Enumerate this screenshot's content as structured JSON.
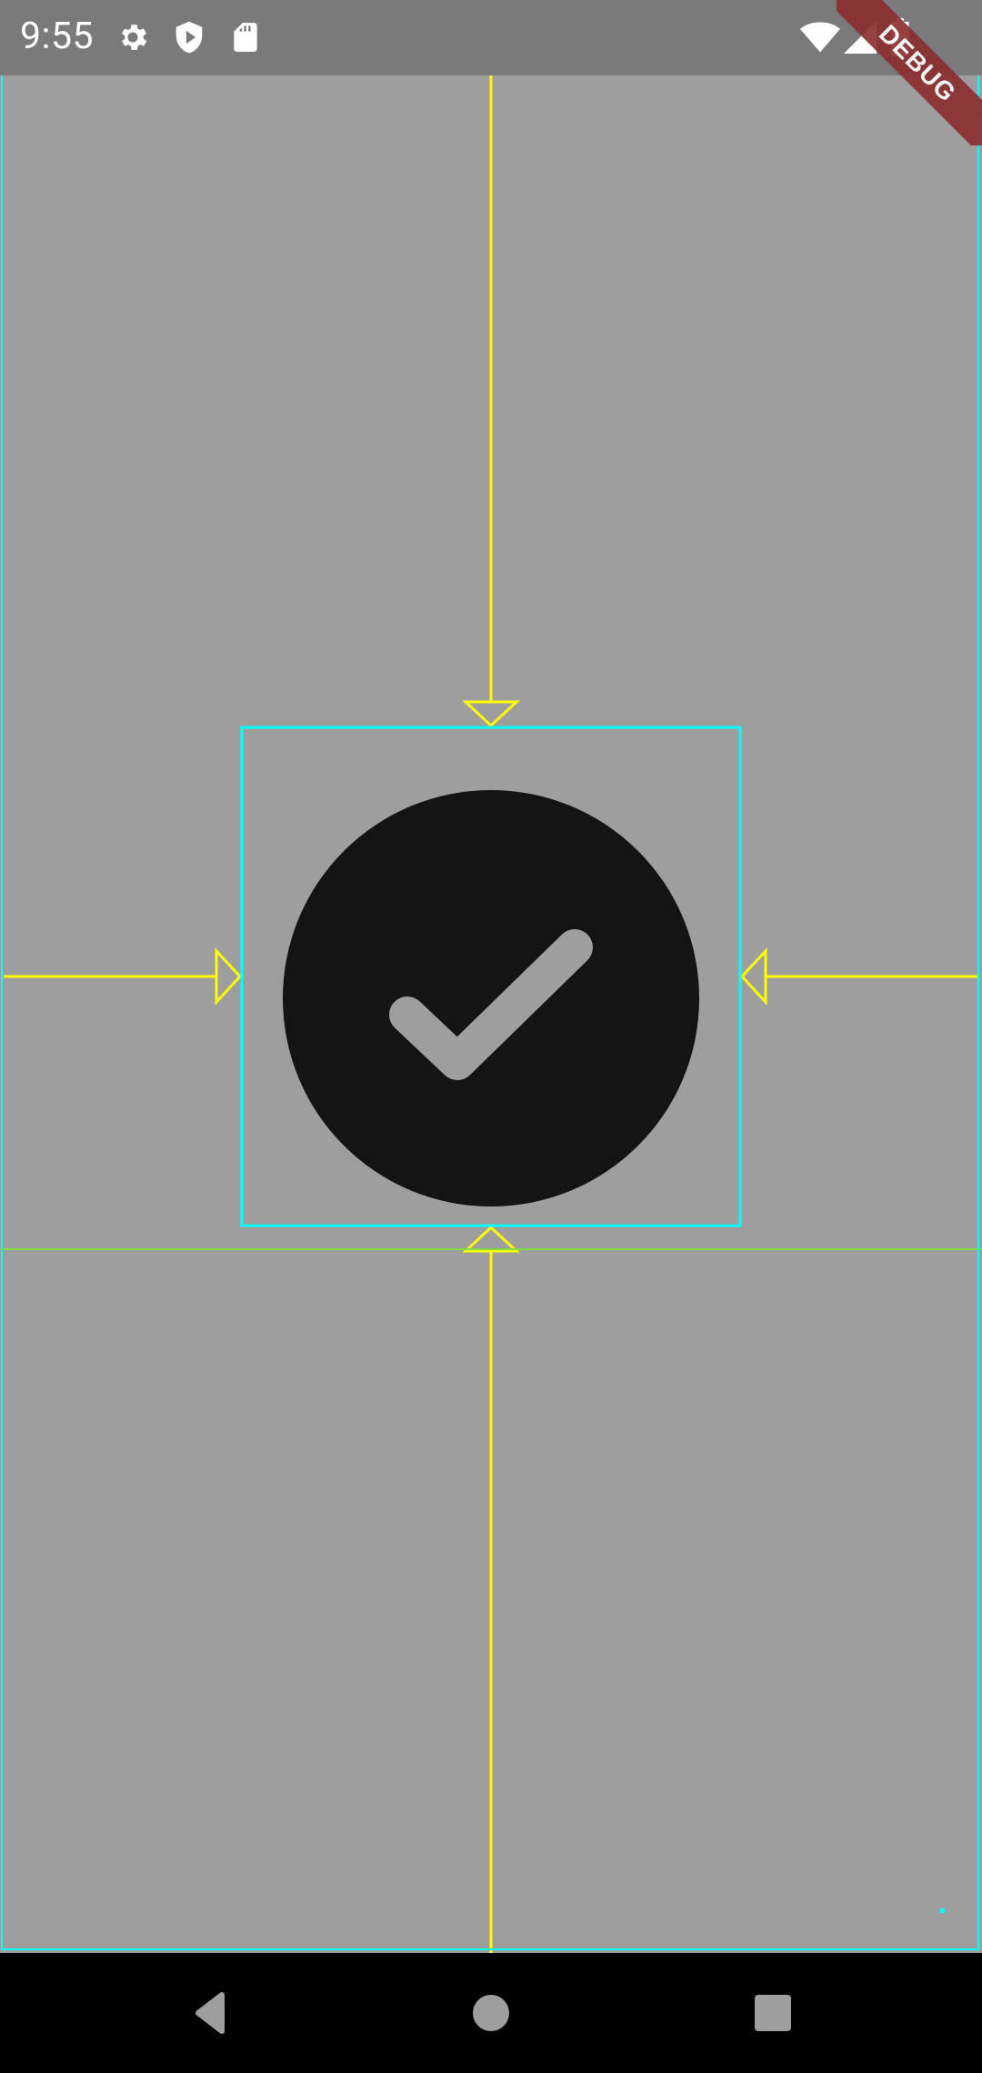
{
  "status_bar": {
    "time": "9:55",
    "left_icons": [
      "gear-icon",
      "shield-play-icon",
      "sd-card-icon"
    ],
    "right_icons": [
      "wifi-icon",
      "signal-icon",
      "battery-icon"
    ],
    "background_color": "#7a7a7a"
  },
  "debug_banner": {
    "label": "DEBUG",
    "color": "#8b2e2e"
  },
  "content": {
    "center_icon": "check-circle-icon",
    "icon_color": "#141414",
    "background_color": "#9e9e9e",
    "outline_color": "#00ffff",
    "guide_color": "#ffff00",
    "baseline_color": "#7fdf3f"
  },
  "nav_bar": {
    "buttons": [
      "back-icon",
      "home-icon",
      "recents-icon"
    ],
    "icon_color": "#9e9e9e"
  }
}
